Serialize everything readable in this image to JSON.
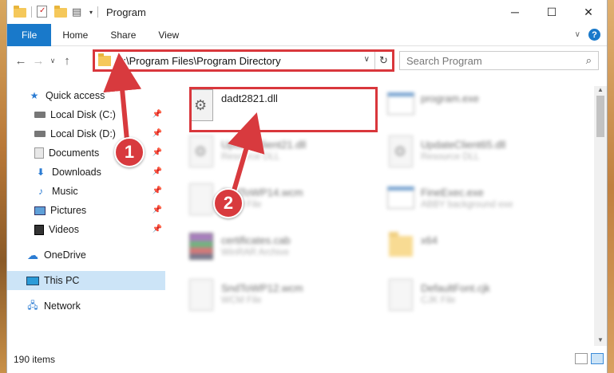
{
  "window": {
    "title": "Program",
    "controls": {
      "minimize": "─",
      "maximize": "☐",
      "close": "✕"
    }
  },
  "ribbon": {
    "tabs": [
      "File",
      "Home",
      "Share",
      "View"
    ],
    "help": "?"
  },
  "address": {
    "path": "C:\\Program Files\\Program Directory",
    "search_placeholder": "Search Program"
  },
  "sidebar": {
    "items": [
      {
        "label": "Quick access",
        "icon": "star-icon",
        "pinned": false
      },
      {
        "label": "Local Disk (C:)",
        "icon": "disk-icon",
        "pinned": true
      },
      {
        "label": "Local Disk (D:)",
        "icon": "disk-icon",
        "pinned": true
      },
      {
        "label": "Documents",
        "icon": "documents-icon",
        "pinned": true
      },
      {
        "label": "Downloads",
        "icon": "download-icon",
        "pinned": true
      },
      {
        "label": "Music",
        "icon": "music-icon",
        "pinned": true
      },
      {
        "label": "Pictures",
        "icon": "pictures-icon",
        "pinned": true
      },
      {
        "label": "Videos",
        "icon": "videos-icon",
        "pinned": true
      },
      {
        "label": "OneDrive",
        "icon": "cloud-icon",
        "pinned": false
      },
      {
        "label": "This PC",
        "icon": "computer-icon",
        "pinned": false,
        "selected": true
      },
      {
        "label": "Network",
        "icon": "network-icon",
        "pinned": false
      }
    ]
  },
  "files": [
    {
      "name": "dadt2821.dll",
      "type": "",
      "icon": "dll-gear-icon",
      "highlighted": true
    },
    {
      "name": "program.exe",
      "type": "",
      "icon": "exe-icon"
    },
    {
      "name": "UpdateClient21.dll",
      "type": "Resource DLL",
      "icon": "dll-gear-icon"
    },
    {
      "name": "UpdateClient65.dll",
      "type": "Resource DLL",
      "icon": "dll-gear-icon"
    },
    {
      "name": "SndToWP14.wcm",
      "type": "WCM File",
      "icon": "file-icon"
    },
    {
      "name": "FineExec.exe",
      "type": "ABBY background exe",
      "icon": "exe-icon"
    },
    {
      "name": "certificates.cab",
      "type": "WinRAR Archive",
      "icon": "archive-icon"
    },
    {
      "name": "x64",
      "type": "",
      "icon": "folder-icon"
    },
    {
      "name": "SndToWP12.wcm",
      "type": "WCM File",
      "icon": "file-icon"
    },
    {
      "name": "DefaultFont.cjk",
      "type": "CJK File",
      "icon": "file-icon"
    }
  ],
  "status": {
    "item_count": "190 items"
  },
  "callouts": [
    "1",
    "2"
  ],
  "colors": {
    "accent": "#1979ca",
    "highlight_red": "#d9373c",
    "selected_bg": "#cce4f7"
  }
}
